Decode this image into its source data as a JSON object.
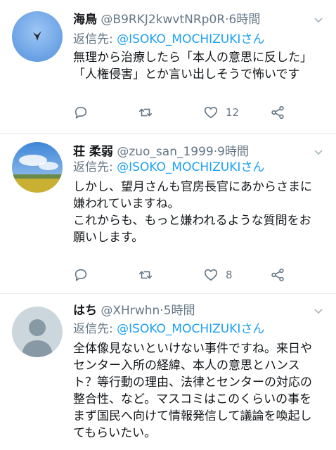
{
  "tweets": [
    {
      "name": "海鳥",
      "handle": "@B9RKJ2kwvtNRp0R",
      "dot": "·",
      "time": "6時間",
      "reply_prefix": "返信先: ",
      "reply_handle": "@ISOKO_MOCHIZUKI",
      "reply_suffix": "さん",
      "text": "無理から治療したら「本人の意思に反した」\n「人権侵害」とか言い出しそうで怖いです",
      "like_count": "12"
    },
    {
      "name": "荘 柔弱",
      "handle": "@zuo_san_1999",
      "dot": "·",
      "time": "9時間",
      "reply_prefix": "返信先: ",
      "reply_handle": "@ISOKO_MOCHIZUKI",
      "reply_suffix": "さん",
      "text": "しかし、望月さんも官房長官にあからさまに\n嫌われていますね。\nこれからも、もっと嫌われるような質問をお\n願いします。",
      "like_count": "8"
    },
    {
      "name": "はち",
      "handle": "@XHrwhn",
      "dot": "·",
      "time": "5時間",
      "reply_prefix": "返信先: ",
      "reply_handle": "@ISOKO_MOCHIZUKI",
      "reply_suffix": "さん",
      "text": "全体像見ないといけない事件ですね。来日や\nセンター入所の経緯、本人の意思とハンス\nト？等行動の理由、法律とセンターの対応の\n整合性、など。マスコミはこのくらいの事を\nまず国民へ向けて情報発信して議論を喚起し\nてもらいたい。"
    }
  ],
  "icons": {
    "reply": "reply-icon",
    "retweet": "retweet-icon",
    "like": "heart-icon",
    "share": "share-icon",
    "menu": "chevron-down-icon"
  },
  "colors": {
    "link": "#1da1f2",
    "muted": "#657786",
    "text": "#14171a",
    "divider": "#e6ecf0"
  }
}
